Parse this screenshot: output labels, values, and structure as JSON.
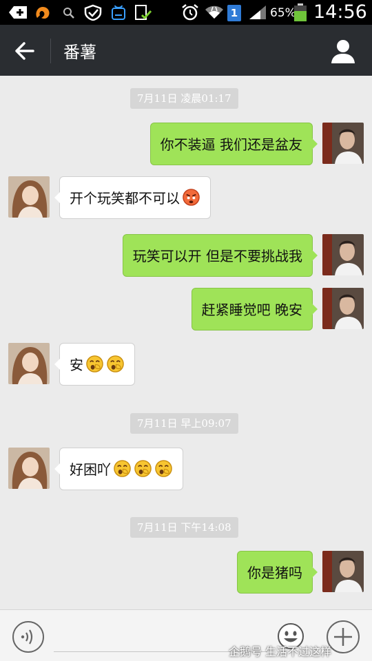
{
  "status_bar": {
    "sim_badge": "1",
    "battery_percent": "65%",
    "clock": "14:56"
  },
  "header": {
    "title": "番薯"
  },
  "messages": [
    {
      "type": "timestamp",
      "text": "7月11日 凌晨01:17"
    },
    {
      "type": "outgoing",
      "text": "你不装逼 我们还是盆友",
      "emoji": []
    },
    {
      "type": "incoming",
      "text": "开个玩笑都不可以",
      "emoji": [
        "angry-face-emoji"
      ]
    },
    {
      "type": "outgoing",
      "text": "玩笑可以开 但是不要挑战我",
      "emoji": []
    },
    {
      "type": "outgoing",
      "text": "赶紧睡觉吧 晚安",
      "emoji": []
    },
    {
      "type": "incoming",
      "text": "安",
      "emoji": [
        "yawning-face-emoji",
        "yawning-face-emoji"
      ]
    },
    {
      "type": "timestamp",
      "text": "7月11日 早上09:07"
    },
    {
      "type": "incoming",
      "text": "好困吖",
      "emoji": [
        "yawning-face-emoji",
        "yawning-face-emoji",
        "yawning-face-emoji"
      ]
    },
    {
      "type": "timestamp",
      "text": "7月11日 下午14:08"
    },
    {
      "type": "outgoing",
      "text": "你是猪吗",
      "emoji": []
    }
  ],
  "watermark": "企鹅号 生活不过这样",
  "colors": {
    "status_bar": "#000000",
    "nav_bar": "#2a2d31",
    "chat_bg": "#ebebeb",
    "outgoing_bubble": "#9fe358",
    "incoming_bubble": "#ffffff",
    "timestamp_bg": "#d6d6d6",
    "input_bar": "#f4f4f4"
  }
}
